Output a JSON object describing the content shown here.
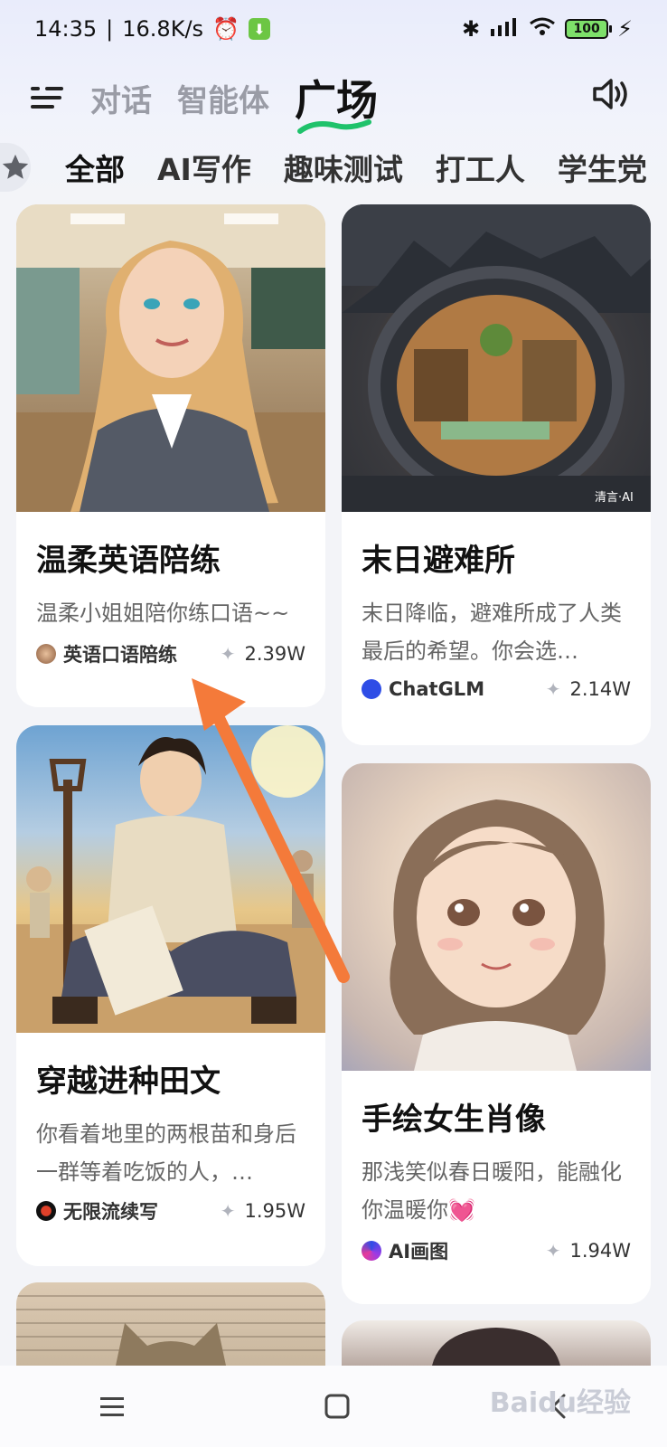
{
  "status_bar": {
    "time": "14:35",
    "speed": "16.8K/s",
    "battery": "100"
  },
  "header": {
    "tabs": [
      "对话",
      "智能体"
    ],
    "active_tab": "广场",
    "speaker_icon": "speaker-icon",
    "menu_icon": "menu-icon"
  },
  "categories": {
    "star_icon": "star-icon",
    "items": [
      "全部",
      "AI写作",
      "趣味测试",
      "打工人",
      "学生党"
    ]
  },
  "cards": [
    {
      "title": "温柔英语陪练",
      "desc": "温柔小姐姐陪你练口语~~",
      "author": "英语口语陪练",
      "count": "2.39W"
    },
    {
      "title": "末日避难所",
      "desc": "末日降临，避难所成了人类最后的希望。你会选…",
      "author": "ChatGLM",
      "count": "2.14W",
      "image_badge": "清言·AI"
    },
    {
      "title": "穿越进种田文",
      "desc": "你看着地里的两根苗和身后一群等着吃饭的人，…",
      "author": "无限流续写",
      "count": "1.95W"
    },
    {
      "title": "手绘女生肖像",
      "desc": "那浅笑似春日暖阳，能融化你温暖你💓",
      "author": "AI画图",
      "count": "1.94W"
    }
  ],
  "bottom_nav": {
    "menu": "menu-icon",
    "home": "home-icon",
    "back": "back-icon"
  },
  "watermark": "Baidu经验",
  "colors": {
    "accent_blue": "#2e4de6",
    "underline_green": "#1fc26b",
    "arrow_orange": "#f47a3a"
  }
}
